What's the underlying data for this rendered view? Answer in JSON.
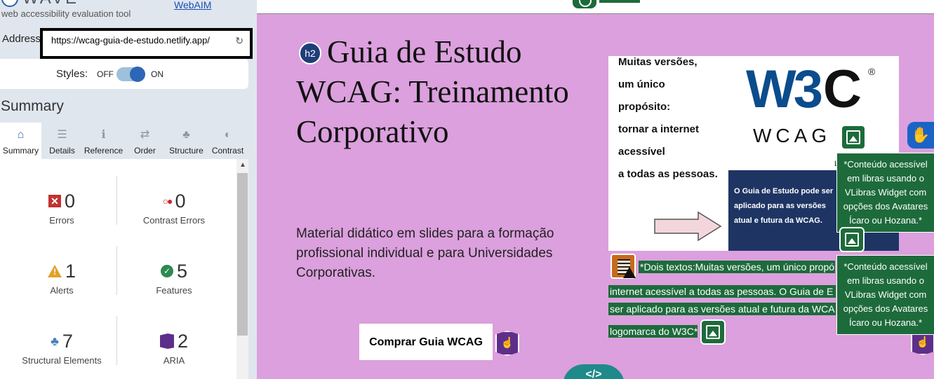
{
  "wave": {
    "title": "WAVE",
    "tagline": "web accessibility evaluation tool",
    "webaim_link": "WebAIM",
    "address_label": "Address:",
    "address_value": "https://wcag-guia-de-estudo.netlify.app/",
    "styles_label": "Styles:",
    "styles_off": "OFF",
    "styles_on": "ON",
    "styles_enabled": true,
    "summary_title": "Summary",
    "tabs": [
      {
        "label": "Summary",
        "icon": "home-icon",
        "glyph": "⌂",
        "active": true
      },
      {
        "label": "Details",
        "icon": "list-icon",
        "glyph": "☰"
      },
      {
        "label": "Reference",
        "icon": "info-icon",
        "glyph": "ℹ"
      },
      {
        "label": "Order",
        "icon": "order-icon",
        "glyph": "⇄"
      },
      {
        "label": "Structure",
        "icon": "structure-icon",
        "glyph": "♣"
      },
      {
        "label": "Contrast",
        "icon": "contrast-icon",
        "glyph": "◐"
      }
    ],
    "stats": {
      "errors": {
        "count": "0",
        "label": "Errors"
      },
      "contrast_errors": {
        "count": "0",
        "label": "Contrast Errors"
      },
      "alerts": {
        "count": "1",
        "label": "Alerts"
      },
      "features": {
        "count": "5",
        "label": "Features"
      },
      "structural": {
        "count": "7",
        "label": "Structural Elements"
      },
      "aria": {
        "count": "2",
        "label": "ARIA"
      }
    }
  },
  "page": {
    "h2_badge": "h2",
    "heading": "Guia de Estudo WCAG: Treinamento Corporativo",
    "description": "Material didático em slides para a formação profissional individual e para Universidades Corporativas.",
    "buy_button": "Comprar Guia WCAG",
    "aria_badge_glyph": "☝",
    "code_badge": "</>",
    "w3c_image": {
      "lines": [
        "Muitas versões,",
        "um único",
        "propósito:",
        "tornar a internet",
        "acessível",
        "a todas as pessoas."
      ],
      "logo": "W3",
      "logo_c": "C",
      "reg": "®",
      "wcag": "WCAG 2",
      "l_text": "L",
      "navy_text": "O Guia de Estudo pode ser aplicado para as versões atual e futura da WCAG."
    },
    "tooltip_text": "*Conteúdo acessível em libras usando o VLibras Widget com opções dos Avatares Ícaro ou Hozana.*",
    "alt_strips": [
      "*Dois textos:Muitas versões, um único propó",
      "internet acessível a todas as pessoas. O Guia de E",
      "ser aplicado para as versões atual e futura da WCA",
      "logomarca do W3C*"
    ],
    "vlibras_glyph": "✋"
  },
  "colors": {
    "page_bg": "#dba0dd",
    "wave_blue": "#2d66b6",
    "feature_green": "#1d6b3b",
    "aria_purple": "#5e2f8a",
    "error_red": "#c23232",
    "alert_yellow": "#e0a328"
  }
}
